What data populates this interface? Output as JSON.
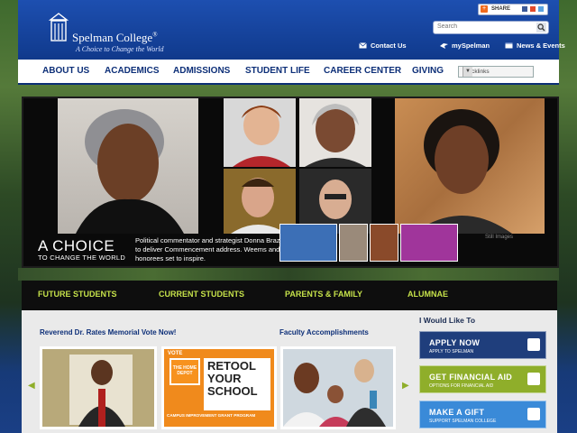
{
  "header": {
    "college_name": "Spelman College",
    "registered": "®",
    "tagline": "A Choice to Change the World",
    "share_label": "SHARE",
    "search_placeholder": "Search",
    "top_links": [
      "Contact Us",
      "mySpelman",
      "News & Events"
    ]
  },
  "nav": {
    "items": [
      "ABOUT US",
      "ACADEMICS",
      "ADMISSIONS",
      "STUDENT LIFE",
      "CAREER CENTER",
      "GIVING"
    ],
    "quicklinks": "Quicklinks"
  },
  "hero": {
    "title": "A CHOICE",
    "subtitle": "TO CHANGE THE WORLD",
    "caption": "Political commentator and strategist Donna Brazile to deliver Commencement address. Weems and honorees set to inspire.",
    "stills_label": "Still Images"
  },
  "audience": [
    "FUTURE STUDENTS",
    "CURRENT STUDENTS",
    "PARENTS & FAMILY",
    "ALUMNAE"
  ],
  "content": {
    "memorial_heading": "Reverend Dr. Rates Memorial Vote Now!",
    "faculty_heading": "Faculty Accomplishments",
    "promo_title_1": "RETOOL",
    "promo_title_2": "YOUR",
    "promo_title_3": "SCHOOL",
    "promo_sub": "CAMPUS IMPROVEMENT GRANT PROGRAM",
    "promo_brand": "THE HOME DEPOT",
    "promo_vote": "VOTE"
  },
  "want": {
    "heading": "I Would Like To",
    "actions": [
      {
        "title": "APPLY NOW",
        "sub": "APPLY TO SPELMAN",
        "color": "#1f3e7c"
      },
      {
        "title": "GET FINANCIAL AID",
        "sub": "OPTIONS FOR FINANCIAL AID",
        "color": "#8fae2a"
      },
      {
        "title": "MAKE A GIFT",
        "sub": "SUPPORT SPELMAN COLLEGE",
        "color": "#3a8ad8"
      }
    ]
  }
}
